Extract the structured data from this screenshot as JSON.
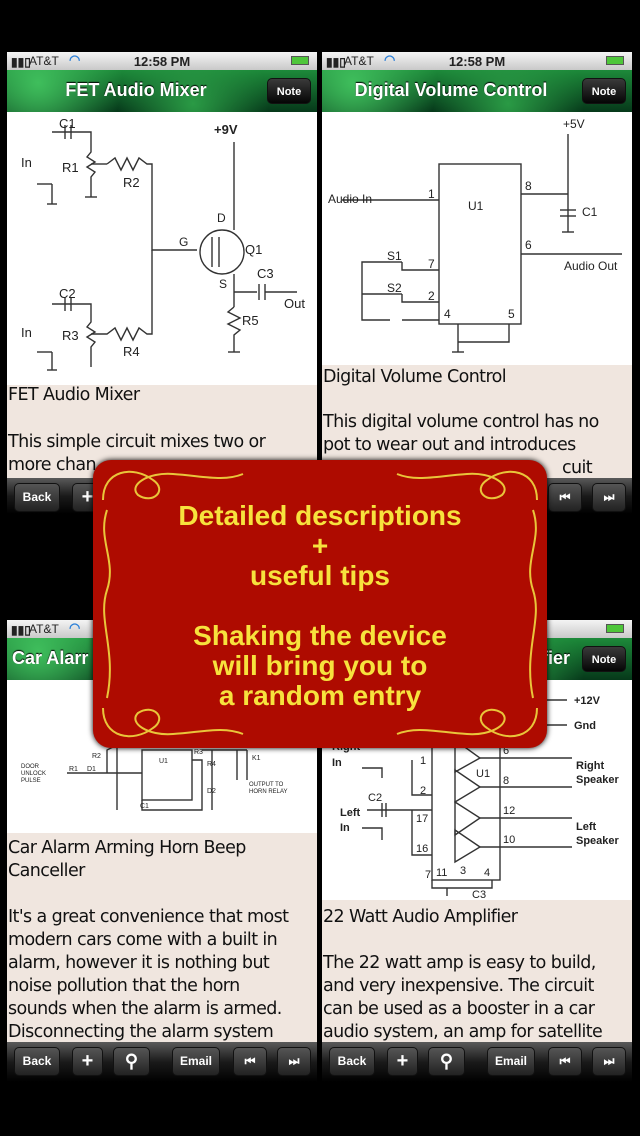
{
  "status_bar": {
    "carrier": "AT&T",
    "time": "12:58 PM"
  },
  "toolbar": {
    "back": "Back",
    "add": "+",
    "email": "Email",
    "icons": [
      "search-icon",
      "skip-back-icon",
      "skip-forward-icon"
    ]
  },
  "panels": [
    {
      "title": "FET Audio Mixer",
      "note": "Note",
      "entry_title": "FET Audio Mixer",
      "body": [
        "This simple circuit mixes two or",
        "more chan"
      ],
      "labels": [
        "C1",
        "In",
        "R1",
        "R2",
        "+9V",
        "D",
        "G",
        "Q1",
        "S",
        "C3",
        "Out",
        "R5",
        "C2",
        "In",
        "R3",
        "R4"
      ]
    },
    {
      "title": "Digital Volume Control",
      "note": "Note",
      "entry_title": "Digital Volume Control",
      "body": [
        "This digital volume control has no",
        "pot to wear out and introduces",
        "cuit"
      ],
      "labels": [
        "+5V",
        "Audio In",
        "1",
        "U1",
        "8",
        "C1",
        "6",
        "Audio Out",
        "S1",
        "7",
        "S2",
        "2",
        "4",
        "5"
      ]
    },
    {
      "title": "Car Alarm Arming Horn Beep Canceller",
      "title_visible": "Car Alarr",
      "note": "Note",
      "entry_title": [
        "Car Alarm Arming Horn Beep",
        "Canceller"
      ],
      "body": [
        "It's a great convenience that most",
        "modern cars come with a built in",
        "alarm, however it is nothing but",
        "noise pollution that the horn",
        "sounds when the alarm is armed.",
        "Disconnecting the alarm system"
      ],
      "labels": [
        "R2",
        "U1",
        "R3",
        "R4",
        "D4",
        "K1",
        "DOOR",
        "UNLOCK",
        "PULSE",
        "R1",
        "D1",
        "C1",
        "D2",
        "OUTPUT TO",
        "HORN RELAY"
      ]
    },
    {
      "title": "22 Watt Audio Amplifier",
      "title_visible": "fier",
      "note": "Note",
      "entry_title": "22 Watt Audio Amplifier",
      "body": [
        "The 22 watt amp is easy to build,",
        "and very inexpensive. The circuit",
        "can be used as a booster in a car",
        "audio system, an amp for satellite"
      ],
      "labels": [
        "+12V",
        "Gnd",
        "Right",
        "In",
        "1",
        "6",
        "U1",
        "Right",
        "Speaker",
        "8",
        "2",
        "C2",
        "Left",
        "In",
        "17",
        "12",
        "Left",
        "Speaker",
        "16",
        "10",
        "7",
        "11",
        "3",
        "4",
        "C3"
      ]
    }
  ],
  "banner": {
    "lines": [
      "Detailed descriptions",
      "+",
      "useful tips",
      "Shaking the device",
      "will bring you to",
      "a random entry"
    ],
    "background": "#ae0b00",
    "text_color": "#f7e23d"
  },
  "colors": {
    "nav_green": "#1d8a3a",
    "page_bg": "#f0e6df"
  }
}
